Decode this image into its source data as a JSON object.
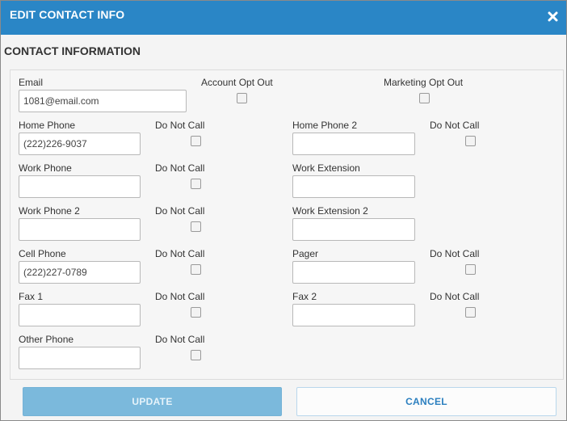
{
  "dialog": {
    "title": "EDIT CONTACT INFO",
    "close_icon": "close-icon"
  },
  "section": {
    "title": "CONTACT INFORMATION"
  },
  "fields": {
    "email": {
      "label": "Email",
      "value": "1081@email.com"
    },
    "account_opt_out": {
      "label": "Account Opt Out",
      "checked": false
    },
    "marketing_opt_out": {
      "label": "Marketing Opt Out",
      "checked": false
    },
    "home_phone": {
      "label": "Home Phone",
      "value": "(222)226-9037"
    },
    "home_phone_dnc": {
      "label": "Do Not Call",
      "checked": false
    },
    "home_phone_2": {
      "label": "Home Phone 2",
      "value": ""
    },
    "home_phone_2_dnc": {
      "label": "Do Not Call",
      "checked": false
    },
    "work_phone": {
      "label": "Work Phone",
      "value": ""
    },
    "work_phone_dnc": {
      "label": "Do Not Call",
      "checked": false
    },
    "work_extension": {
      "label": "Work Extension",
      "value": ""
    },
    "work_phone_2": {
      "label": "Work Phone 2",
      "value": ""
    },
    "work_phone_2_dnc": {
      "label": "Do Not Call",
      "checked": false
    },
    "work_extension_2": {
      "label": "Work Extension 2",
      "value": ""
    },
    "cell_phone": {
      "label": "Cell Phone",
      "value": "(222)227-0789"
    },
    "cell_phone_dnc": {
      "label": "Do Not Call",
      "checked": false
    },
    "pager": {
      "label": "Pager",
      "value": ""
    },
    "pager_dnc": {
      "label": "Do Not Call",
      "checked": false
    },
    "fax_1": {
      "label": "Fax 1",
      "value": ""
    },
    "fax_1_dnc": {
      "label": "Do Not Call",
      "checked": false
    },
    "fax_2": {
      "label": "Fax 2",
      "value": ""
    },
    "fax_2_dnc": {
      "label": "Do Not Call",
      "checked": false
    },
    "other_phone": {
      "label": "Other Phone",
      "value": ""
    },
    "other_phone_dnc": {
      "label": "Do Not Call",
      "checked": false
    }
  },
  "actions": {
    "update_label": "UPDATE",
    "cancel_label": "CANCEL"
  },
  "colors": {
    "titlebar": "#2a86c6",
    "update_button": "#7bb9dc",
    "cancel_text": "#2b7fbf"
  }
}
